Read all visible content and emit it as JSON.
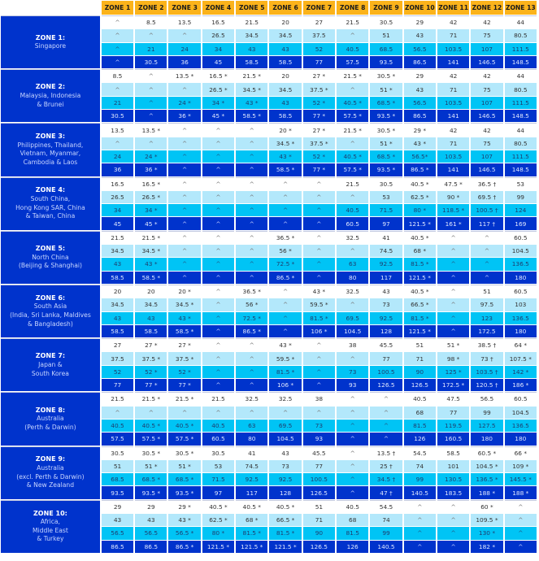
{
  "table": {
    "columns": [
      "ZONE 1",
      "ZONE 2",
      "ZONE 3",
      "ZONE 4",
      "ZONE 5",
      "ZONE 6",
      "ZONE 7",
      "ZONE 8",
      "ZONE 9",
      "ZONE 10",
      "ZONE 11",
      "ZONE 12",
      "ZONE 13"
    ],
    "legend_symbols": {
      "caret": "^",
      "asterisk": "*",
      "dagger": "†"
    },
    "colors": {
      "header": "#fbb31b",
      "zone_label": "#0033cc",
      "row_white": "#ffffff",
      "row_light_blue": "#b3e8fb",
      "row_cyan": "#00c4f5",
      "row_dark_blue": "#0033cc"
    },
    "zones": [
      {
        "name": "ZONE 1:",
        "description": "Singapore",
        "rows": [
          [
            "^",
            "8.5",
            "13.5",
            "16.5",
            "21.5",
            "20",
            "27",
            "21.5",
            "30.5",
            "29",
            "42",
            "42",
            "44"
          ],
          [
            "^",
            "^",
            "^",
            "26.5",
            "34.5",
            "34.5",
            "37.5",
            "^",
            "51",
            "43",
            "71",
            "75",
            "80.5"
          ],
          [
            "^",
            "21",
            "24",
            "34",
            "43",
            "43",
            "52",
            "40.5",
            "68.5",
            "56.5",
            "103.5",
            "107",
            "111.5"
          ],
          [
            "^",
            "30.5",
            "36",
            "45",
            "58.5",
            "58.5",
            "77",
            "57.5",
            "93.5",
            "86.5",
            "141",
            "146.5",
            "148.5"
          ]
        ]
      },
      {
        "name": "ZONE 2:",
        "description": "Malaysia, Indonesia\n& Brunei",
        "rows": [
          [
            "8.5",
            "^",
            "13.5 *",
            "16.5 *",
            "21.5 *",
            "20",
            "27 *",
            "21.5 *",
            "30.5 *",
            "29",
            "42",
            "42",
            "44"
          ],
          [
            "^",
            "^",
            "^",
            "26.5 *",
            "34.5 *",
            "34.5",
            "37.5 *",
            "^",
            "51 *",
            "43",
            "71",
            "75",
            "80.5"
          ],
          [
            "21",
            "^",
            "24 *",
            "34 *",
            "43 *",
            "43",
            "52 *",
            "40.5 *",
            "68.5 *",
            "56.5",
            "103.5",
            "107",
            "111.5"
          ],
          [
            "30.5",
            "^",
            "36 *",
            "45 *",
            "58.5 *",
            "58.5",
            "77 *",
            "57.5 *",
            "93.5 *",
            "86.5",
            "141",
            "146.5",
            "148.5"
          ]
        ]
      },
      {
        "name": "ZONE 3:",
        "description": "Philippines, Thailand,\nVietnam, Myanmar,\nCambodia & Laos",
        "rows": [
          [
            "13.5",
            "13.5 *",
            "^",
            "^",
            "^",
            "20 *",
            "27 *",
            "21.5 *",
            "30.5 *",
            "29 *",
            "42",
            "42",
            "44"
          ],
          [
            "^",
            "^",
            "^",
            "^",
            "^",
            "34.5 *",
            "37.5 *",
            "^",
            "51 *",
            "43 *",
            "71",
            "75",
            "80.5"
          ],
          [
            "24",
            "24 *",
            "^",
            "^",
            "^",
            "43 *",
            "52 *",
            "40.5 *",
            "68.5 *",
            "56.5*",
            "103.5",
            "107",
            "111.5"
          ],
          [
            "36",
            "36 *",
            "^",
            "^",
            "^",
            "58.5 *",
            "77 *",
            "57.5 *",
            "93.5 *",
            "86.5 *",
            "141",
            "146.5",
            "148.5"
          ]
        ]
      },
      {
        "name": "ZONE 4:",
        "description": "South China,\nHong Kong SAR, China\n& Taiwan, China",
        "rows": [
          [
            "16.5",
            "16.5 *",
            "^",
            "^",
            "^",
            "^",
            "^",
            "21.5",
            "30.5",
            "40.5 *",
            "47.5 *",
            "36.5 †",
            "53"
          ],
          [
            "26.5",
            "26.5 *",
            "^",
            "^",
            "^",
            "^",
            "^",
            "^",
            "53",
            "62.5 *",
            "90 *",
            "69.5 †",
            "99"
          ],
          [
            "34",
            "34 *",
            "^",
            "^",
            "^",
            "^",
            "^",
            "40.5",
            "71.5",
            "80 *",
            "118.5 *",
            "100.5 †",
            "124"
          ],
          [
            "45",
            "45 *",
            "^",
            "^",
            "^",
            "^",
            "^",
            "60.5",
            "97",
            "121.5 *",
            "161 *",
            "117 †",
            "169"
          ]
        ]
      },
      {
        "name": "ZONE 5:",
        "description": "North China\n(Beijing & Shanghai)",
        "rows": [
          [
            "21.5",
            "21.5 *",
            "^",
            "^",
            "^",
            "36.5 *",
            "^",
            "32.5",
            "41",
            "40.5 *",
            "^",
            "^",
            "60.5"
          ],
          [
            "34.5",
            "34.5 *",
            "^",
            "^",
            "^",
            "56 *",
            "^",
            "^",
            "74.5",
            "68 *",
            "^",
            "^",
            "104.5"
          ],
          [
            "43",
            "43 *",
            "^",
            "^",
            "^",
            "72.5 *",
            "^",
            "63",
            "92.5",
            "81.5 *",
            "^",
            "^",
            "136.5"
          ],
          [
            "58.5",
            "58.5 *",
            "^",
            "^",
            "^",
            "86.5 *",
            "^",
            "80",
            "117",
            "121.5 *",
            "^",
            "^",
            "180"
          ]
        ]
      },
      {
        "name": "ZONE 6:",
        "description": "South Asia\n(India, Sri Lanka, Maldives\n& Bangladesh)",
        "rows": [
          [
            "20",
            "20",
            "20 *",
            "^",
            "36.5 *",
            "^",
            "43 *",
            "32.5",
            "43",
            "40.5 *",
            "^",
            "51",
            "60.5"
          ],
          [
            "34.5",
            "34.5",
            "34.5 *",
            "^",
            "56 *",
            "^",
            "59.5 *",
            "^",
            "73",
            "66.5 *",
            "^",
            "97.5",
            "103"
          ],
          [
            "43",
            "43",
            "43 *",
            "^",
            "72.5 *",
            "^",
            "81.5 *",
            "69.5",
            "92.5",
            "81.5 *",
            "^",
            "123",
            "136.5"
          ],
          [
            "58.5",
            "58.5",
            "58.5 *",
            "^",
            "86.5 *",
            "^",
            "106 *",
            "104.5",
            "128",
            "121.5 *",
            "^",
            "172.5",
            "180"
          ]
        ]
      },
      {
        "name": "ZONE 7:",
        "description": "Japan &\nSouth Korea",
        "rows": [
          [
            "27",
            "27 *",
            "27 *",
            "^",
            "^",
            "43 *",
            "^",
            "38",
            "45.5",
            "51",
            "51 *",
            "38.5 †",
            "64 *"
          ],
          [
            "37.5",
            "37.5 *",
            "37.5 *",
            "^",
            "^",
            "59.5 *",
            "^",
            "^",
            "77",
            "71",
            "98 *",
            "73 †",
            "107.5 *"
          ],
          [
            "52",
            "52 *",
            "52 *",
            "^",
            "^",
            "81.5 *",
            "^",
            "73",
            "100.5",
            "90",
            "125 *",
            "103.5 †",
            "142 *"
          ],
          [
            "77",
            "77 *",
            "77 *",
            "^",
            "^",
            "106 *",
            "^",
            "93",
            "126.5",
            "126.5",
            "172.5 *",
            "120.5 †",
            "186 *"
          ]
        ]
      },
      {
        "name": "ZONE 8:",
        "description": "Australia\n(Perth & Darwin)",
        "rows": [
          [
            "21.5",
            "21.5 *",
            "21.5 *",
            "21.5",
            "32.5",
            "32.5",
            "38",
            "^",
            "^",
            "40.5",
            "47.5",
            "56.5",
            "60.5"
          ],
          [
            "^",
            "^",
            "^",
            "^",
            "^",
            "^",
            "^",
            "^",
            "^",
            "68",
            "77",
            "99",
            "104.5"
          ],
          [
            "40.5",
            "40.5 *",
            "40.5 *",
            "40.5",
            "63",
            "69.5",
            "73",
            "^",
            "^",
            "81.5",
            "119.5",
            "127.5",
            "136.5"
          ],
          [
            "57.5",
            "57.5 *",
            "57.5 *",
            "60.5",
            "80",
            "104.5",
            "93",
            "^",
            "^",
            "126",
            "160.5",
            "180",
            "180"
          ]
        ]
      },
      {
        "name": "ZONE 9:",
        "description": "Australia\n(excl. Perth & Darwin)\n& New Zealand",
        "rows": [
          [
            "30.5",
            "30.5 *",
            "30.5 *",
            "30.5",
            "41",
            "43",
            "45.5",
            "^",
            "13.5 †",
            "54.5",
            "58.5",
            "60.5 *",
            "66 *"
          ],
          [
            "51",
            "51 *",
            "51 *",
            "53",
            "74.5",
            "73",
            "77",
            "^",
            "25 †",
            "74",
            "101",
            "104.5 *",
            "109 *"
          ],
          [
            "68.5",
            "68.5 *",
            "68.5 *",
            "71.5",
            "92.5",
            "92.5",
            "100.5",
            "^",
            "34.5 †",
            "99",
            "130.5",
            "136.5 *",
            "145.5 *"
          ],
          [
            "93.5",
            "93.5 *",
            "93.5 *",
            "97",
            "117",
            "128",
            "126.5",
            "^",
            "47 †",
            "140.5",
            "183.5",
            "188 *",
            "188 *"
          ]
        ]
      },
      {
        "name": "ZONE 10:",
        "description": "Africa,\nMiddle East\n& Turkey",
        "rows": [
          [
            "29",
            "29",
            "29 *",
            "40.5 *",
            "40.5 *",
            "40.5 *",
            "51",
            "40.5",
            "54.5",
            "^",
            "^",
            "60 *",
            "^"
          ],
          [
            "43",
            "43",
            "43 *",
            "62.5 *",
            "68 *",
            "66.5 *",
            "71",
            "68",
            "74",
            "^",
            "^",
            "109.5 *",
            "^"
          ],
          [
            "56.5",
            "56.5",
            "56.5 *",
            "80 *",
            "81.5 *",
            "81.5 *",
            "90",
            "81.5",
            "99",
            "^",
            "^",
            "130 *",
            "^"
          ],
          [
            "86.5",
            "86.5",
            "86.5 *",
            "121.5 *",
            "121.5 *",
            "121.5 *",
            "126.5",
            "126",
            "140.5",
            "^",
            "^",
            "182 *",
            "^"
          ]
        ]
      }
    ]
  }
}
